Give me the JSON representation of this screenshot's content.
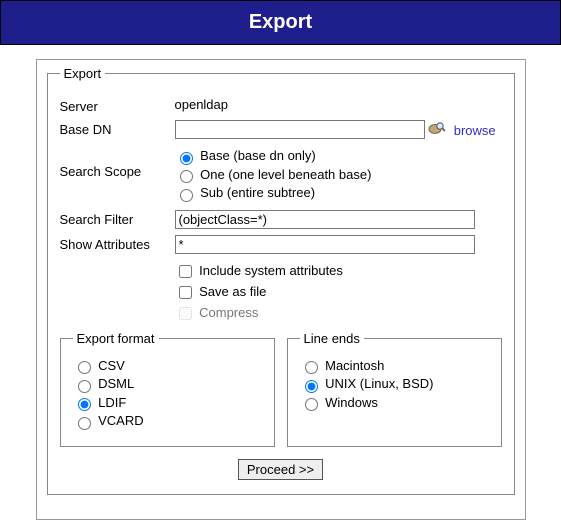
{
  "header": {
    "title": "Export"
  },
  "fieldset": {
    "legend": "Export",
    "server_label": "Server",
    "server_value": "openldap",
    "basedn_label": "Base DN",
    "basedn_value": "",
    "browse_label": "browse",
    "scope_label": "Search Scope",
    "scope": {
      "base": "Base (base dn only)",
      "one": "One (one level beneath base)",
      "sub": "Sub (entire subtree)"
    },
    "filter_label": "Search Filter",
    "filter_value": "(objectClass=*)",
    "attrs_label": "Show Attributes",
    "attrs_value": "*",
    "include_sys": "Include system attributes",
    "save_file": "Save as file",
    "compress": "Compress"
  },
  "format": {
    "legend": "Export format",
    "csv": "CSV",
    "dsml": "DSML",
    "ldif": "LDIF",
    "vcard": "VCARD"
  },
  "lineends": {
    "legend": "Line ends",
    "mac": "Macintosh",
    "unix": "UNIX (Linux, BSD)",
    "win": "Windows"
  },
  "proceed": "Proceed >>"
}
